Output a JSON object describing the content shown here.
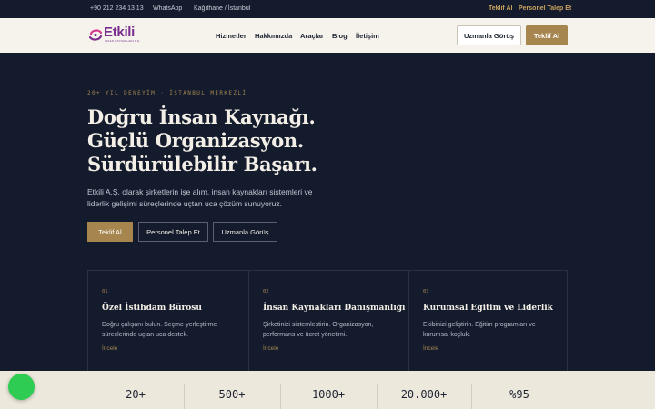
{
  "topbar": {
    "phone": "+90 212 234 13 13",
    "whatsapp": "WhatsApp",
    "location": "Kağıthane / İstanbul",
    "quote": "Teklif Al",
    "staff_request": "Personel Talep Et"
  },
  "header": {
    "logo_text": "Etkili",
    "logo_sub": "İNSAN KAYNAKLARI A.Ş.",
    "nav": [
      "Hizmetler",
      "Hakkımızda",
      "Araçlar",
      "Blog",
      "İletişim"
    ],
    "expert_button": "Uzmanla Görüş",
    "quote_button": "Teklif Al"
  },
  "hero": {
    "eyebrow": "20+ YIL DENEYİM · İSTANBUL MERKEZLİ",
    "headline": [
      "Doğru İnsan Kaynağı.",
      "Güçlü Organizasyon.",
      "Sürdürülebilir Başarı."
    ],
    "lead": "Etkili A.Ş. olarak şirketlerin işe alım, insan kaynakları sistemleri ve liderlik gelişimi süreçlerinde uçtan uca çözüm sunuyoruz.",
    "buttons": {
      "quote": "Teklif Al",
      "staff": "Personel Talep Et",
      "expert": "Uzmanla Görüş"
    }
  },
  "services": [
    {
      "num": "01",
      "title": "Özel İstihdam Bürosu",
      "desc": "Doğru çalışanı bulun. Seçme-yerleştirme süreçlerinde uçtan uca destek.",
      "link": "İncele"
    },
    {
      "num": "02",
      "title": "İnsan Kaynakları Danışmanlığı",
      "desc": "Şirketinizi sistemleştirin. Organizasyon, performans ve ücret yönetimi.",
      "link": "İncele"
    },
    {
      "num": "03",
      "title": "Kurumsal Eğitim ve Liderlik",
      "desc": "Ekibinizi geliştirin. Eğitim programları ve kurumsal koçluk.",
      "link": "İncele"
    }
  ],
  "stats": [
    "20+",
    "500+",
    "1000+",
    "20.000+",
    "%95"
  ],
  "colors": {
    "navy": "#141b2d",
    "gold": "#a6854e",
    "cream": "#f6f3ec",
    "whatsapp": "#2ecc52"
  }
}
